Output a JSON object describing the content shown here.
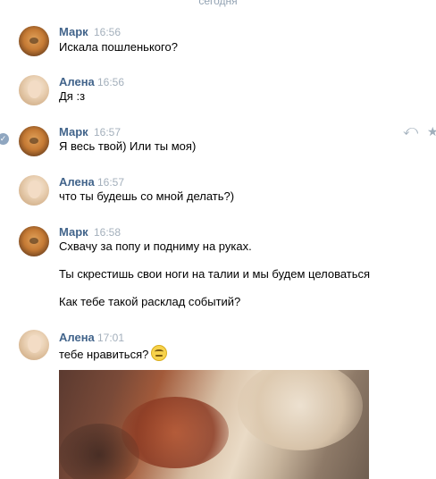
{
  "day_separator": "сегодня",
  "messages": [
    {
      "author": "Марк",
      "time": "16:56",
      "lines": [
        "Искала пошленького?"
      ]
    },
    {
      "author": "Алена",
      "time": "16:56",
      "lines": [
        "Дя :з"
      ]
    },
    {
      "author": "Марк",
      "time": "16:57",
      "lines": [
        "Я весь твой) Или ты моя)"
      ]
    },
    {
      "author": "Алена",
      "time": "16:57",
      "lines": [
        "что ты будешь со мной делать?)"
      ]
    },
    {
      "author": "Марк",
      "time": "16:58",
      "lines": [
        "Схвачу за попу и подниму на руках.",
        "Ты скрестишь свои ноги на талии и мы будем целоваться",
        "Как тебе такой расклад событий?"
      ]
    },
    {
      "author": "Алена",
      "time": "17:01",
      "lines": [
        "тебе нравиться?"
      ],
      "emoji": "rolling-eyes-emoji",
      "attachment": "photo"
    }
  ],
  "hover_actions": {
    "check": "✓",
    "reply": "⤺",
    "star": "★"
  }
}
